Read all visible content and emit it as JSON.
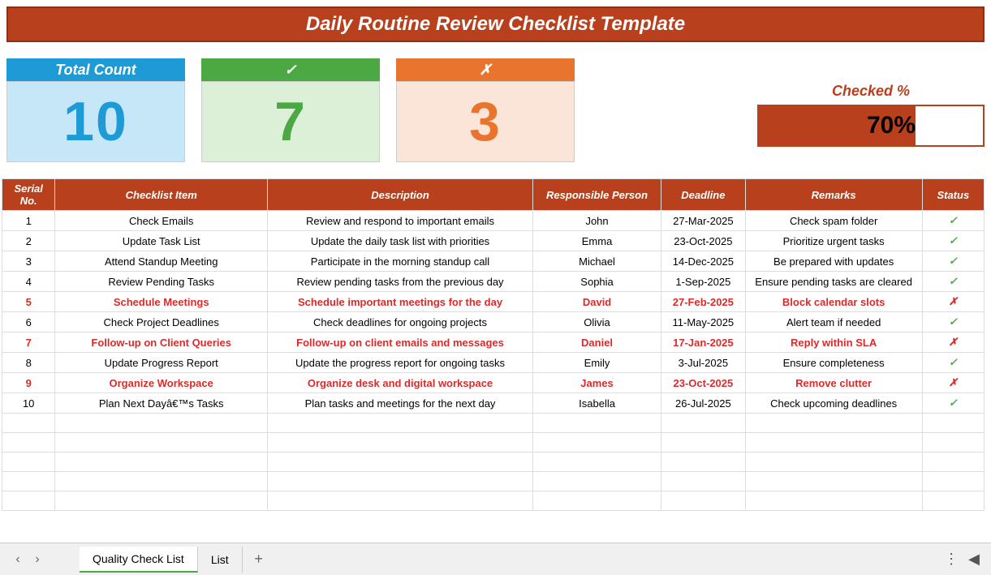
{
  "title": "Daily Routine Review Checklist Template",
  "stats": {
    "total": {
      "label": "Total Count",
      "value": "10"
    },
    "checked": {
      "label": "✓",
      "value": "7"
    },
    "unchecked": {
      "label": "✗",
      "value": "3"
    },
    "percent": {
      "label": "Checked %",
      "value": "70%",
      "width": "70%"
    }
  },
  "headers": {
    "serial": "Serial No.",
    "item": "Checklist Item",
    "desc": "Description",
    "person": "Responsible Person",
    "deadline": "Deadline",
    "remarks": "Remarks",
    "status": "Status"
  },
  "rows": [
    {
      "serial": "1",
      "item": "Check Emails",
      "desc": "Review and respond to important emails",
      "person": "John",
      "deadline": "27-Mar-2025",
      "remarks": "Check spam folder",
      "status": "✓",
      "checked": true
    },
    {
      "serial": "2",
      "item": "Update Task List",
      "desc": "Update the daily task list with priorities",
      "person": "Emma",
      "deadline": "23-Oct-2025",
      "remarks": "Prioritize urgent tasks",
      "status": "✓",
      "checked": true
    },
    {
      "serial": "3",
      "item": "Attend Standup Meeting",
      "desc": "Participate in the morning standup call",
      "person": "Michael",
      "deadline": "14-Dec-2025",
      "remarks": "Be prepared with updates",
      "status": "✓",
      "checked": true
    },
    {
      "serial": "4",
      "item": "Review Pending Tasks",
      "desc": "Review pending tasks from the previous day",
      "person": "Sophia",
      "deadline": "1-Sep-2025",
      "remarks": "Ensure pending tasks are cleared",
      "status": "✓",
      "checked": true
    },
    {
      "serial": "5",
      "item": "Schedule Meetings",
      "desc": "Schedule important meetings for the day",
      "person": "David",
      "deadline": "27-Feb-2025",
      "remarks": "Block calendar slots",
      "status": "✗",
      "checked": false
    },
    {
      "serial": "6",
      "item": "Check Project Deadlines",
      "desc": "Check deadlines for ongoing projects",
      "person": "Olivia",
      "deadline": "11-May-2025",
      "remarks": "Alert team if needed",
      "status": "✓",
      "checked": true
    },
    {
      "serial": "7",
      "item": "Follow-up on Client Queries",
      "desc": "Follow-up on client emails and messages",
      "person": "Daniel",
      "deadline": "17-Jan-2025",
      "remarks": "Reply within SLA",
      "status": "✗",
      "checked": false
    },
    {
      "serial": "8",
      "item": "Update Progress Report",
      "desc": "Update the progress report for ongoing tasks",
      "person": "Emily",
      "deadline": "3-Jul-2025",
      "remarks": "Ensure completeness",
      "status": "✓",
      "checked": true
    },
    {
      "serial": "9",
      "item": "Organize Workspace",
      "desc": "Organize desk and digital workspace",
      "person": "James",
      "deadline": "23-Oct-2025",
      "remarks": "Remove clutter",
      "status": "✗",
      "checked": false
    },
    {
      "serial": "10",
      "item": "Plan Next Dayâ€™s Tasks",
      "desc": "Plan tasks and meetings for the next day",
      "person": "Isabella",
      "deadline": "26-Jul-2025",
      "remarks": "Check upcoming deadlines",
      "status": "✓",
      "checked": true
    }
  ],
  "emptyRows": 5,
  "tabs": {
    "active": "Quality Check List",
    "other": "List",
    "add": "+"
  },
  "chart_data": {
    "type": "table",
    "title": "Daily Routine Review Checklist Template",
    "summary": {
      "total": 10,
      "checked": 7,
      "unchecked": 3,
      "percent": 70
    },
    "columns": [
      "Serial No.",
      "Checklist Item",
      "Description",
      "Responsible Person",
      "Deadline",
      "Remarks",
      "Status"
    ],
    "rows": [
      [
        1,
        "Check Emails",
        "Review and respond to important emails",
        "John",
        "27-Mar-2025",
        "Check spam folder",
        "checked"
      ],
      [
        2,
        "Update Task List",
        "Update the daily task list with priorities",
        "Emma",
        "23-Oct-2025",
        "Prioritize urgent tasks",
        "checked"
      ],
      [
        3,
        "Attend Standup Meeting",
        "Participate in the morning standup call",
        "Michael",
        "14-Dec-2025",
        "Be prepared with updates",
        "checked"
      ],
      [
        4,
        "Review Pending Tasks",
        "Review pending tasks from the previous day",
        "Sophia",
        "1-Sep-2025",
        "Ensure pending tasks are cleared",
        "checked"
      ],
      [
        5,
        "Schedule Meetings",
        "Schedule important meetings for the day",
        "David",
        "27-Feb-2025",
        "Block calendar slots",
        "unchecked"
      ],
      [
        6,
        "Check Project Deadlines",
        "Check deadlines for ongoing projects",
        "Olivia",
        "11-May-2025",
        "Alert team if needed",
        "checked"
      ],
      [
        7,
        "Follow-up on Client Queries",
        "Follow-up on client emails and messages",
        "Daniel",
        "17-Jan-2025",
        "Reply within SLA",
        "unchecked"
      ],
      [
        8,
        "Update Progress Report",
        "Update the progress report for ongoing tasks",
        "Emily",
        "3-Jul-2025",
        "Ensure completeness",
        "checked"
      ],
      [
        9,
        "Organize Workspace",
        "Organize desk and digital workspace",
        "James",
        "23-Oct-2025",
        "Remove clutter",
        "unchecked"
      ],
      [
        10,
        "Plan Next Day's Tasks",
        "Plan tasks and meetings for the next day",
        "Isabella",
        "26-Jul-2025",
        "Check upcoming deadlines",
        "checked"
      ]
    ]
  }
}
